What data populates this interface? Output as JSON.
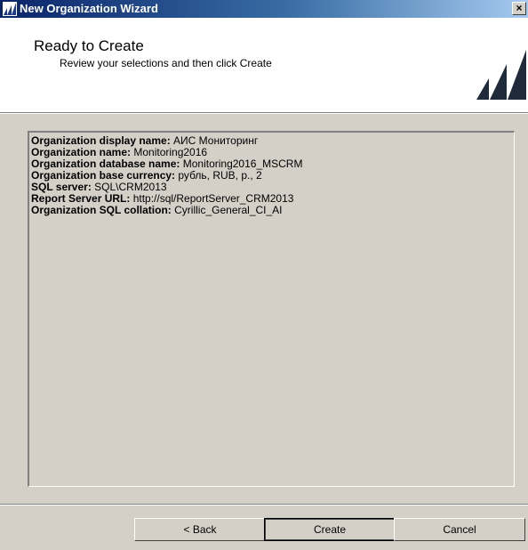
{
  "window": {
    "title": "New Organization Wizard",
    "close_glyph": "×"
  },
  "header": {
    "title": "Ready to Create",
    "subtitle": "Review your selections and then click Create",
    "logo_icon": "dynamics-logo-icon"
  },
  "summary": [
    {
      "label": "Organization display name:",
      "value": "АИС Мониторинг"
    },
    {
      "label": "Organization name:",
      "value": "Monitoring2016"
    },
    {
      "label": "Organization database name:",
      "value": "Monitoring2016_MSCRM"
    },
    {
      "label": "Organization base currency:",
      "value": "рубль, RUB, р., 2"
    },
    {
      "label": "SQL server:",
      "value": "SQL\\CRM2013"
    },
    {
      "label": "Report Server URL:",
      "value": "http://sql/ReportServer_CRM2013"
    },
    {
      "label": "Organization SQL collation:",
      "value": "Cyrillic_General_CI_AI"
    }
  ],
  "buttons": {
    "back": "< Back",
    "create": "Create",
    "cancel": "Cancel"
  },
  "colors": {
    "titlebar_start": "#0a246a",
    "window_face": "#d4d0c8",
    "logo": "#1f2a3a"
  }
}
